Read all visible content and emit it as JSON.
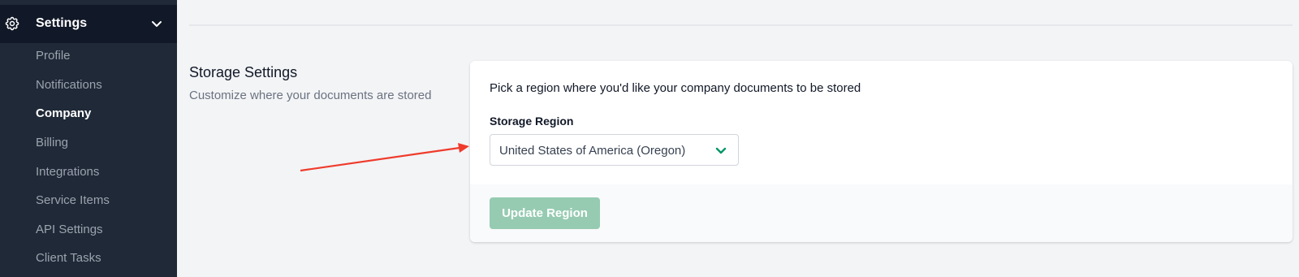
{
  "sidebar": {
    "header": {
      "label": "Settings",
      "icon": "gear-icon",
      "chevron": "chevron-down-icon"
    },
    "items": [
      {
        "label": "Profile",
        "active": false
      },
      {
        "label": "Notifications",
        "active": false
      },
      {
        "label": "Company",
        "active": true
      },
      {
        "label": "Billing",
        "active": false
      },
      {
        "label": "Integrations",
        "active": false
      },
      {
        "label": "Service Items",
        "active": false
      },
      {
        "label": "API Settings",
        "active": false
      },
      {
        "label": "Client Tasks",
        "active": false
      }
    ]
  },
  "section": {
    "title": "Storage Settings",
    "description": "Customize where your documents are stored"
  },
  "card": {
    "description": "Pick a region where you'd like your company documents to be stored",
    "field_label": "Storage Region",
    "select_value": "United States of America (Oregon)",
    "button_label": "Update Region"
  },
  "colors": {
    "sidebar_bg": "#1f2937",
    "sidebar_header_bg": "#111827",
    "accent": "#059669",
    "button_disabled": "#96cbb2",
    "annotation_arrow": "#ef3b2c"
  }
}
